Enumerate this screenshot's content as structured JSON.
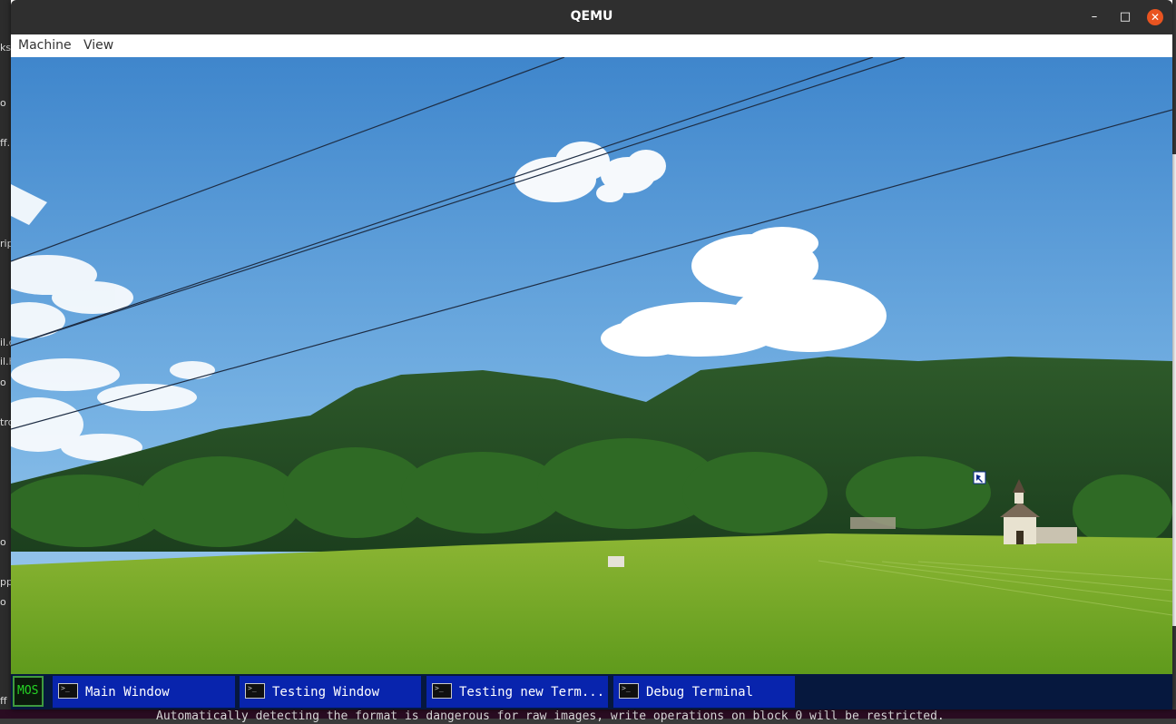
{
  "window": {
    "title": "QEMU",
    "controls": {
      "minimize": "–",
      "maximize": "□",
      "close": "✕"
    }
  },
  "menubar": {
    "items": [
      "Machine",
      "View"
    ]
  },
  "background_fragments": [
    "ks",
    "o",
    "ff.",
    "rip",
    "il.c",
    "il.h",
    "o",
    "tro",
    "o",
    "pp",
    "o",
    "ff"
  ],
  "background_terminal_text": "Automatically detecting the format is dangerous for raw images, write operations on block 0 will be restricted.",
  "taskbar": {
    "start_label": "MOS",
    "tasks": [
      {
        "label": "Main Window",
        "icon": "terminal-icon"
      },
      {
        "label": "Testing Window",
        "icon": "terminal-icon"
      },
      {
        "label": "Testing new Term...",
        "icon": "terminal-icon"
      },
      {
        "label": "Debug Terminal",
        "icon": "terminal-icon"
      }
    ]
  },
  "wallpaper": "landscape-photo",
  "colors": {
    "titlebar": "#2f2f2f",
    "close": "#e95420",
    "taskbar": "#06183e",
    "task_button": "#0824ad",
    "start_green": "#25d525"
  }
}
